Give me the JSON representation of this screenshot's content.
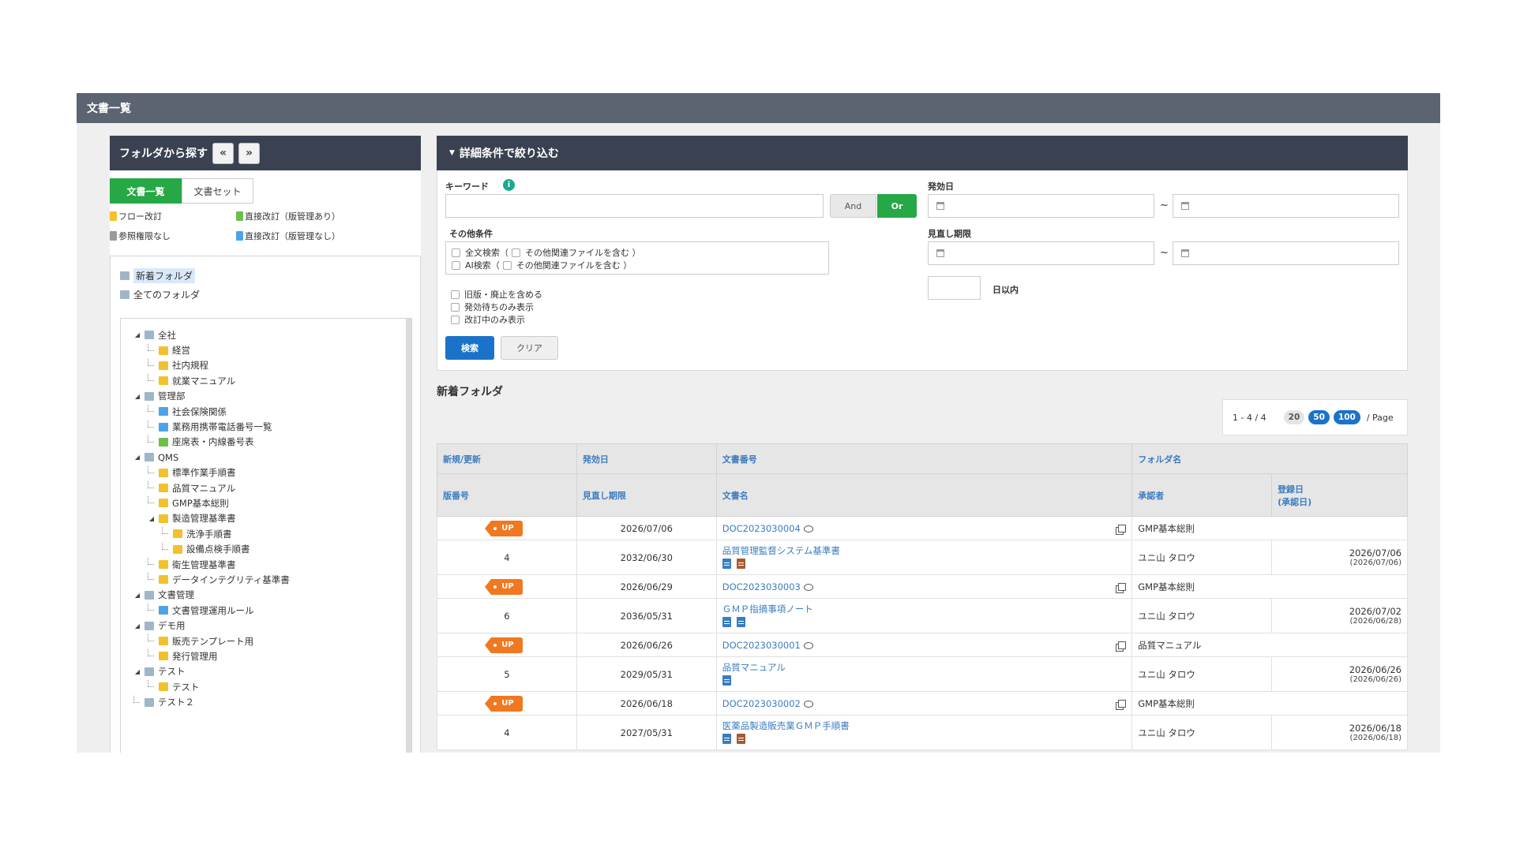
{
  "window": {
    "title": "文書一覧"
  },
  "left": {
    "title": "フォルダから探す",
    "prev_label": "«",
    "next_label": "»",
    "tabs": [
      {
        "label": "文書一覧"
      },
      {
        "label": "文書セット"
      }
    ],
    "legend": [
      {
        "label": "フロー改訂",
        "color": "#f2c12e"
      },
      {
        "label": "直接改訂（版管理あり）",
        "color": "#6cc04a"
      },
      {
        "label": "参照権限なし",
        "color": "#9a9a9a"
      },
      {
        "label": "直接改訂（版管理なし）",
        "color": "#4da3e8"
      }
    ],
    "quick": [
      {
        "label": "新着フォルダ"
      },
      {
        "label": "全てのフォルダ"
      }
    ],
    "tree": [
      {
        "label": "全社"
      },
      {
        "label": "経営"
      },
      {
        "label": "社内規程"
      },
      {
        "label": "就業マニュアル"
      },
      {
        "label": "管理部"
      },
      {
        "label": "社会保険関係"
      },
      {
        "label": "業務用携帯電話番号一覧"
      },
      {
        "label": "座席表・内線番号表"
      },
      {
        "label": "QMS"
      },
      {
        "label": "標準作業手順書"
      },
      {
        "label": "品質マニュアル"
      },
      {
        "label": "GMP基本総則"
      },
      {
        "label": "製造管理基準書"
      },
      {
        "label": "洗浄手順書"
      },
      {
        "label": "設備点検手順書"
      },
      {
        "label": "衛生管理基準書"
      },
      {
        "label": "データインテグリティ基準書"
      },
      {
        "label": "文書管理"
      },
      {
        "label": "文書管理運用ルール"
      },
      {
        "label": "デモ用"
      },
      {
        "label": "販売テンプレート用"
      },
      {
        "label": "発行管理用"
      },
      {
        "label": "テスト"
      },
      {
        "label": "テスト"
      },
      {
        "label": "テスト２"
      }
    ]
  },
  "filter": {
    "title": "詳細条件で絞り込む",
    "keyword_label": "キーワード",
    "and_label": "And",
    "or_label": "Or",
    "effective_label": "発効日",
    "review_label": "見直し期限",
    "tilde": "~",
    "days_label": "日以内",
    "other_label": "その他条件",
    "fulltext": "全文検索（",
    "fulltext_related": "その他関連ファイルを含む ）",
    "ai": "AI検索（",
    "ai_related": "その他関連ファイルを含む ）",
    "opt_old": "旧版・廃止を含める",
    "opt_pending": "発効待ちのみ表示",
    "opt_revising": "改訂中のみ表示",
    "search_label": "検索",
    "clear_label": "クリア"
  },
  "list": {
    "title": "新着フォルダ",
    "pager": {
      "range": "1 - 4 / 4",
      "sizes": [
        "20",
        "50",
        "100"
      ],
      "per_page": "/ Page"
    },
    "headers": {
      "new": "新規/更新",
      "effective": "発効日",
      "docno": "文書番号",
      "folder": "フォルダ名",
      "version": "版番号",
      "review": "見直し期限",
      "docname": "文書名",
      "approver": "承認者",
      "registered": "登録日",
      "approved": "(承認日)"
    },
    "rows": [
      {
        "badge": "UP",
        "effective": "2026/07/06",
        "docno": "DOC2023030004",
        "folder": "GMP基本総則",
        "version": "4",
        "review": "2032/06/30",
        "docname": "品質管理監督システム基準書",
        "approver": "ユニ山 タロウ",
        "registered": "2026/07/06",
        "approved": "(2026/07/06)"
      },
      {
        "badge": "UP",
        "effective": "2026/06/29",
        "docno": "DOC2023030003",
        "folder": "GMP基本総則",
        "version": "6",
        "review": "2036/05/31",
        "docname": "ＧＭＰ指摘事項ノート",
        "approver": "ユニ山 タロウ",
        "registered": "2026/07/02",
        "approved": "(2026/06/28)"
      },
      {
        "badge": "UP",
        "effective": "2026/06/26",
        "docno": "DOC2023030001",
        "folder": "品質マニュアル",
        "version": "5",
        "review": "2029/05/31",
        "docname": "品質マニュアル",
        "approver": "ユニ山 タロウ",
        "registered": "2026/06/26",
        "approved": "(2026/06/26)"
      },
      {
        "badge": "UP",
        "effective": "2026/06/18",
        "docno": "DOC2023030002",
        "folder": "GMP基本総則",
        "version": "4",
        "review": "2027/05/31",
        "docname": "医薬品製造販売業ＧＭＰ手順書",
        "approver": "ユニ山 タロウ",
        "registered": "2026/06/18",
        "approved": "(2026/06/18)"
      }
    ]
  },
  "colors": {
    "header": "#5b6470",
    "panel": "#3a4150",
    "green": "#25a845",
    "blue": "#1a73c8",
    "orange": "#f07820",
    "link": "#3a7cc1"
  }
}
